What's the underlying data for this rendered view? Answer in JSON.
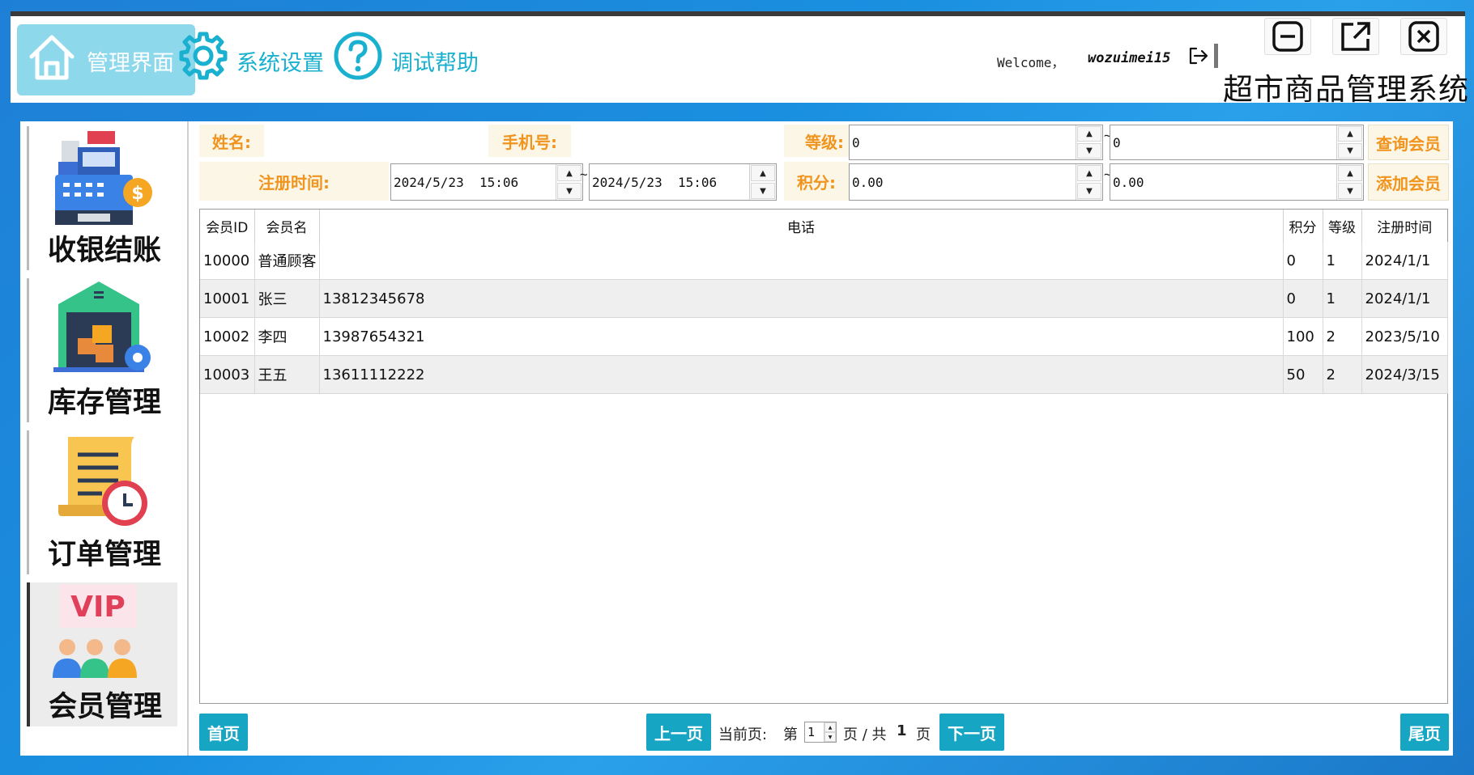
{
  "header": {
    "nav": [
      {
        "label": "管理界面",
        "icon": "home-icon"
      },
      {
        "label": "系统设置",
        "icon": "gear-icon"
      },
      {
        "label": "调试帮助",
        "icon": "help-icon"
      }
    ],
    "welcome": "Welcome，",
    "username": "wozuimei15",
    "app_title": "超市商品管理系统",
    "window_buttons": [
      "minimize-icon",
      "popout-icon",
      "close-icon"
    ]
  },
  "sidebar": {
    "items": [
      {
        "label": "收银结账",
        "icon": "cash-register-icon",
        "active": false
      },
      {
        "label": "库存管理",
        "icon": "warehouse-icon",
        "active": false
      },
      {
        "label": "订单管理",
        "icon": "order-list-icon",
        "active": false
      },
      {
        "label": "会员管理",
        "icon": "vip-members-icon",
        "active": true
      }
    ]
  },
  "filters": {
    "name_label": "姓名:",
    "name_value": "",
    "phone_label": "手机号:",
    "phone_value": "",
    "level_label": "等级:",
    "level_min": "0",
    "level_max": "0",
    "regtime_label": "注册时间:",
    "regtime_from": "2024/5/23  15:06",
    "regtime_to": "2024/5/23  15:06",
    "points_label": "积分:",
    "points_min": "0.00",
    "points_max": "0.00",
    "tilde": "~",
    "query_button": "查询会员",
    "add_button": "添加会员"
  },
  "table": {
    "columns": [
      "会员ID",
      "会员名",
      "电话",
      "积分",
      "等级",
      "注册时间"
    ],
    "rows": [
      [
        "10000",
        "普通顾客",
        "",
        "0",
        "1",
        "2024/1/1"
      ],
      [
        "10001",
        "张三",
        "13812345678",
        "0",
        "1",
        "2024/1/1"
      ],
      [
        "10002",
        "李四",
        "13987654321",
        "100",
        "2",
        "2023/5/10"
      ],
      [
        "10003",
        "王五",
        "13611112222",
        "50",
        "2",
        "2024/3/15"
      ]
    ]
  },
  "pager": {
    "first": "首页",
    "prev": "上一页",
    "current_label": "当前页:",
    "page_prefix": "第",
    "current_page": "1",
    "page_suffix": "页 / 共",
    "total_pages": "1",
    "total_suffix": "页",
    "next": "下一页",
    "last": "尾页"
  },
  "colors": {
    "accent": "#17a5c4",
    "label_orange": "#f0941e",
    "label_bg": "#fbf6e6"
  }
}
